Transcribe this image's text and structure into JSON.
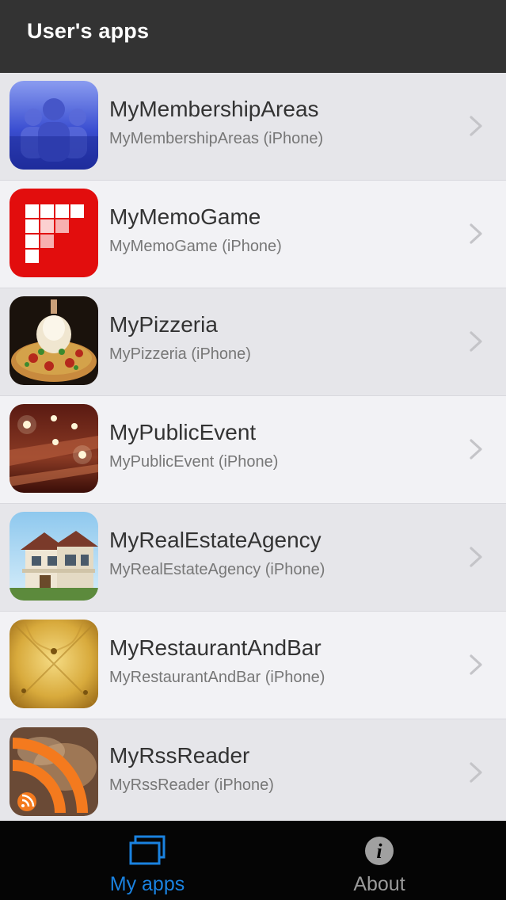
{
  "header": {
    "title": "User's apps"
  },
  "apps": [
    {
      "name": "MyMembershipAreas",
      "subtitle": "MyMembershipAreas (iPhone)",
      "icon": "membership-people-icon"
    },
    {
      "name": "MyMemoGame",
      "subtitle": "MyMemoGame (iPhone)",
      "icon": "memo-game-grid-icon"
    },
    {
      "name": "MyPizzeria",
      "subtitle": "MyPizzeria (iPhone)",
      "icon": "pizza-icon"
    },
    {
      "name": "MyPublicEvent",
      "subtitle": "MyPublicEvent (iPhone)",
      "icon": "event-hall-icon"
    },
    {
      "name": "MyRealEstateAgency",
      "subtitle": "MyRealEstateAgency (iPhone)",
      "icon": "house-icon"
    },
    {
      "name": "MyRestaurantAndBar",
      "subtitle": "MyRestaurantAndBar (iPhone)",
      "icon": "gold-tufted-icon"
    },
    {
      "name": "MyRssReader",
      "subtitle": "MyRssReader (iPhone)",
      "icon": "rss-icon"
    }
  ],
  "tabbar": {
    "tabs": [
      {
        "label": "My apps",
        "icon": "stacked-screens-icon",
        "selected": true
      },
      {
        "label": "About",
        "icon": "info-icon",
        "selected": false
      }
    ]
  },
  "colors": {
    "nav_background": "#333333",
    "tab_selected": "#1a82e0",
    "tab_unselected": "#9a9a9a",
    "tabbar_background": "#050505"
  }
}
